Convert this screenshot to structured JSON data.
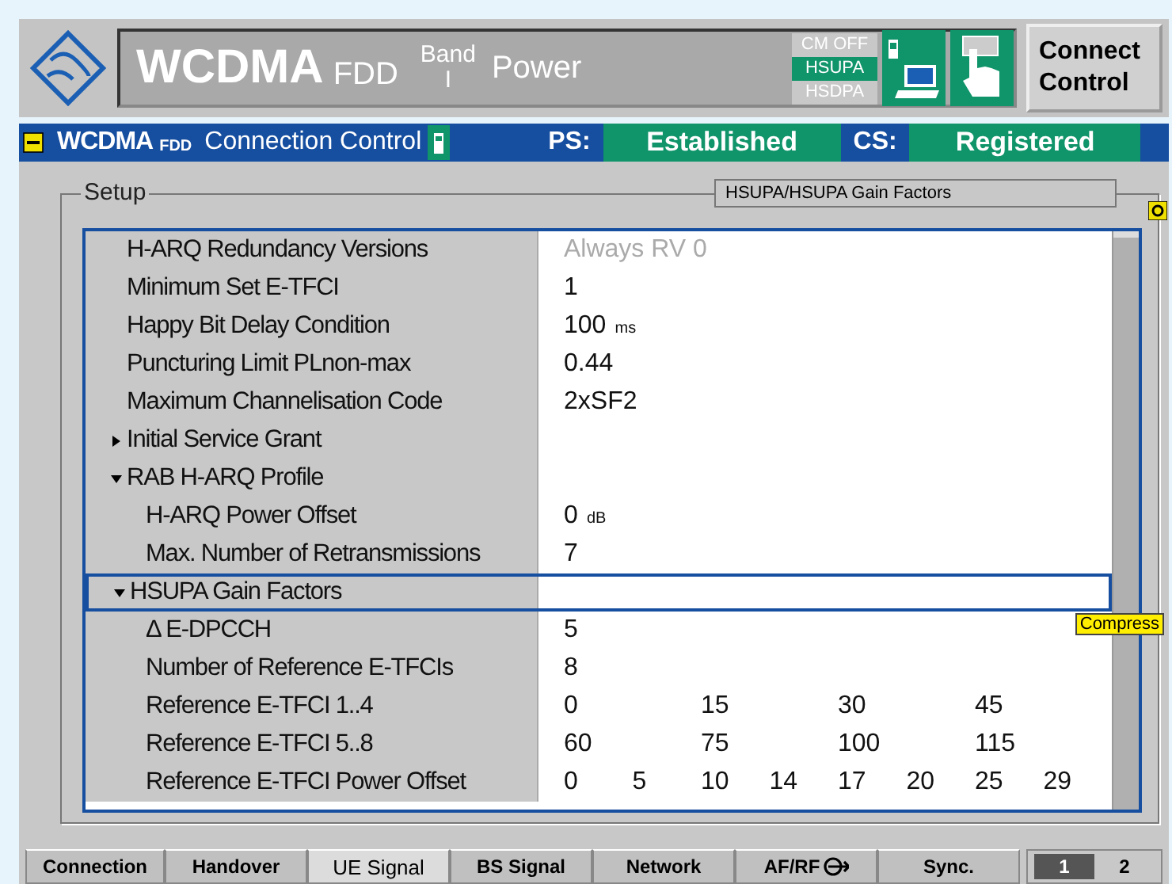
{
  "header": {
    "title": "WCDMA",
    "title_suffix": "FDD",
    "band_label": "Band",
    "band_value": "I",
    "mode": "Power",
    "status_flags": [
      {
        "label": "CM OFF",
        "selected": false
      },
      {
        "label": "HSUPA",
        "selected": true
      },
      {
        "label": "HSDPA",
        "selected": false
      }
    ],
    "connect_button": "Connect Control"
  },
  "connection_bar": {
    "title": "WCDMA",
    "title_suffix": "FDD",
    "subtitle": "Connection Control",
    "ps_label": "PS:",
    "ps_state": "Established",
    "cs_label": "CS:",
    "cs_state": "Registered"
  },
  "setup": {
    "legend": "Setup",
    "breadcrumb": "HSUPA/HSUPA Gain Factors",
    "tooltip": "Compress",
    "rows": [
      {
        "kind": "leaf",
        "label": "H-ARQ Redundancy Versions",
        "values": [
          "Always RV 0"
        ],
        "disabled": true,
        "selected": false
      },
      {
        "kind": "leaf",
        "label": "Minimum Set E-TFCI",
        "values": [
          "1"
        ],
        "disabled": false,
        "selected": false
      },
      {
        "kind": "leaf",
        "label": "Happy Bit Delay Condition",
        "values": [
          "100"
        ],
        "unit": "ms",
        "disabled": false,
        "selected": false
      },
      {
        "kind": "leaf",
        "label": "Puncturing Limit PLnon-max",
        "values": [
          "0.44"
        ],
        "disabled": false,
        "selected": false
      },
      {
        "kind": "leaf",
        "label": "Maximum Channelisation Code",
        "values": [
          "2xSF2"
        ],
        "disabled": false,
        "selected": false
      },
      {
        "kind": "group",
        "label": "Initial Service Grant",
        "expanded": false,
        "selected": false
      },
      {
        "kind": "group",
        "label": "RAB H-ARQ Profile",
        "expanded": true,
        "selected": false,
        "children": [
          {
            "kind": "leaf",
            "label": "H-ARQ Power Offset",
            "values": [
              "0"
            ],
            "unit": "dB",
            "disabled": false,
            "selected": false
          },
          {
            "kind": "leaf",
            "label": "Max. Number of Retransmissions",
            "values": [
              "7"
            ],
            "disabled": false,
            "selected": false
          }
        ]
      },
      {
        "kind": "group",
        "label": "HSUPA Gain Factors",
        "expanded": true,
        "selected": true,
        "children": [
          {
            "kind": "leaf",
            "label": "Δ E-DPCCH",
            "values": [
              "5"
            ],
            "disabled": false,
            "selected": false
          },
          {
            "kind": "leaf",
            "label": "Number of Reference E-TFCIs",
            "values": [
              "8"
            ],
            "disabled": false,
            "selected": false
          },
          {
            "kind": "leaf",
            "label": "Reference E-TFCI 1..4",
            "values": [
              "0",
              "15",
              "30",
              "45"
            ],
            "disabled": false,
            "selected": false
          },
          {
            "kind": "leaf",
            "label": "Reference E-TFCI 5..8",
            "values": [
              "60",
              "75",
              "100",
              "115"
            ],
            "disabled": false,
            "selected": false
          },
          {
            "kind": "leaf",
            "label": "Reference E-TFCI Power Offset",
            "values": [
              "0",
              "5",
              "10",
              "14",
              "17",
              "20",
              "25",
              "29"
            ],
            "disabled": false,
            "selected": false
          }
        ]
      }
    ]
  },
  "tabs": [
    {
      "label": "Connection",
      "selected": false
    },
    {
      "label": "Handover",
      "selected": false
    },
    {
      "label": "UE Signal",
      "selected": true
    },
    {
      "label": "BS Signal",
      "selected": false
    },
    {
      "label": "Network",
      "selected": false
    },
    {
      "label": "AF/RF",
      "icon": true,
      "selected": false
    },
    {
      "label": "Sync.",
      "selected": false
    }
  ],
  "pages": [
    {
      "label": "1",
      "selected": true
    },
    {
      "label": "2",
      "selected": false
    }
  ]
}
